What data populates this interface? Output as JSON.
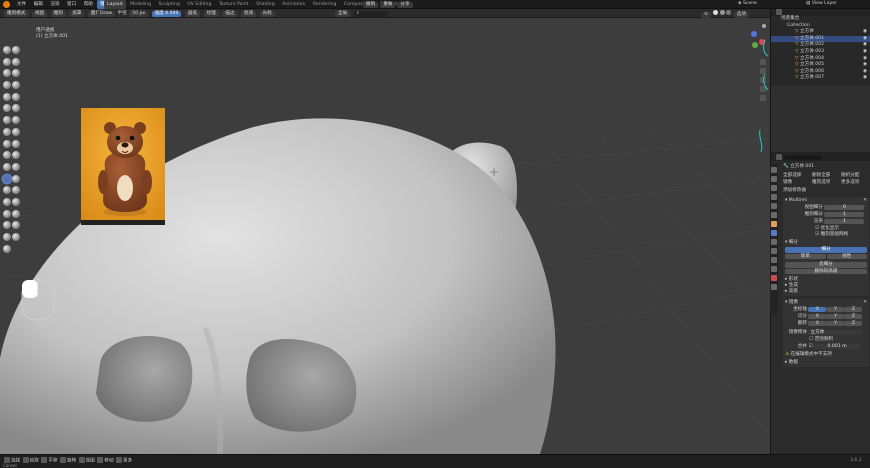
{
  "topbar": {
    "menu": [
      "文件",
      "编辑",
      "渲染",
      "窗口",
      "帮助"
    ],
    "workspace_tabs": [
      "Layout",
      "Modeling",
      "Sculpting",
      "UV Editing",
      "Texture Paint",
      "Shading",
      "Animation",
      "Rendering",
      "Compositing",
      "Scripting"
    ],
    "active_tab": "Layout",
    "scene_label": "Scene",
    "view_layer_label": "View Layer"
  },
  "viewport_header": {
    "mode": "雕刻模式",
    "menus": [
      "视图",
      "雕刻",
      "遮罩",
      "面组",
      "Face Sets"
    ],
    "brush_name": "Draw",
    "radius_label": "半径",
    "radius_value": "50 px",
    "strength_label": "强度",
    "strength_value": "0.500",
    "options": [
      "画笔",
      "纹理",
      "描边",
      "衰减",
      "光标"
    ],
    "orientation": "全局",
    "shading_label": "选项"
  },
  "viewport": {
    "view_name": "用户透视",
    "object_line": "(1) 立方体.001",
    "colors": {
      "bg": "#3d3d3d",
      "mesh": "#cfcfcf",
      "accent": "#4772b3"
    }
  },
  "reference_image": {
    "subject": "cartoon-bear-figure"
  },
  "outliner": {
    "title": "场景集合",
    "collection": "Collection",
    "items": [
      "立方体",
      "立方体.001",
      "立方体.002",
      "立方体.003",
      "立方体.004",
      "立方体.005",
      "立方体.006",
      "立方体.007"
    ],
    "selected_index": 1
  },
  "properties": {
    "search_placeholder": "",
    "object_name": "立方体.001",
    "toggles": [
      "全部选择",
      "删除全部",
      "随机分配",
      "镜像",
      "雕刻选项",
      "更多选项"
    ],
    "add_modifier": "添加修改器",
    "modifier1": {
      "name": "Multires",
      "fields": [
        {
          "label": "视图细分",
          "value": "0"
        },
        {
          "label": "雕刻细分",
          "value": "1"
        },
        {
          "label": "渲染",
          "value": "1"
        }
      ],
      "checks": [
        "优化显示",
        "雕刻基础网格"
      ],
      "subdivide_header": "细分",
      "btn_subdivide": "细分",
      "btn_simple": "简单",
      "btn_linear": "线性",
      "btn_unsubdivide": "反细分",
      "btn_delete_higher": "删除较高级",
      "sections": [
        "形状",
        "生成",
        "高级"
      ]
    },
    "modifier2": {
      "name": "镜像",
      "axis_label": "坐标轴",
      "bisect_label": "切分",
      "flip_label": "翻转",
      "axes": [
        "X",
        "Y",
        "Z"
      ],
      "mirror_object_label": "镜像物体",
      "mirror_object_value": "立方体",
      "clipping_label": "范围限制",
      "merge_label": "合并",
      "merge_value": "0.001 m",
      "warning": "在编辑模式中不支持",
      "data_section": "数据"
    }
  },
  "statusbar": {
    "left": [
      "选择",
      "拾取",
      "平移",
      "旋转",
      "视图",
      "移动",
      "更多"
    ],
    "right": "3.6.2",
    "cancel": "Cancel"
  }
}
